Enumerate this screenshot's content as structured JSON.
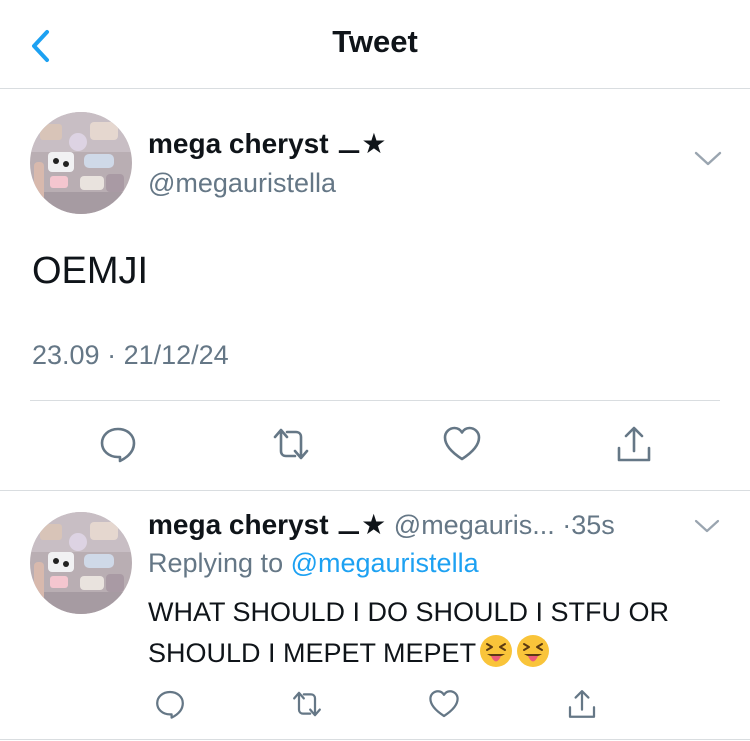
{
  "nav": {
    "title": "Tweet"
  },
  "main_tweet": {
    "display_name": "mega cheryst",
    "name_symbols": "⚊★",
    "handle": "@megauristella",
    "text": "OEMJI",
    "time": "23.09",
    "date": "21/12/24",
    "meta_separator": " · "
  },
  "reply_tweet": {
    "display_name": "mega cheryst",
    "name_symbols": "⚊★",
    "handle_truncated": "@megauris...",
    "age": "·35s",
    "replying_prefix": "Replying to ",
    "replying_to": "@megauristella",
    "text": "WHAT SHOULD I DO SHOULD I STFU OR SHOULD I MEPET MEPET"
  },
  "icons": {
    "back": "chevron-left-icon",
    "more": "chevron-down-icon",
    "reply": "comment-icon",
    "retweet": "retweet-icon",
    "like": "heart-icon",
    "share": "share-icon",
    "emoji": "squinting-face-with-tongue"
  },
  "colors": {
    "accent": "#1da1f2",
    "text": "#0f1419",
    "muted": "#657786",
    "icon": "#657786"
  }
}
